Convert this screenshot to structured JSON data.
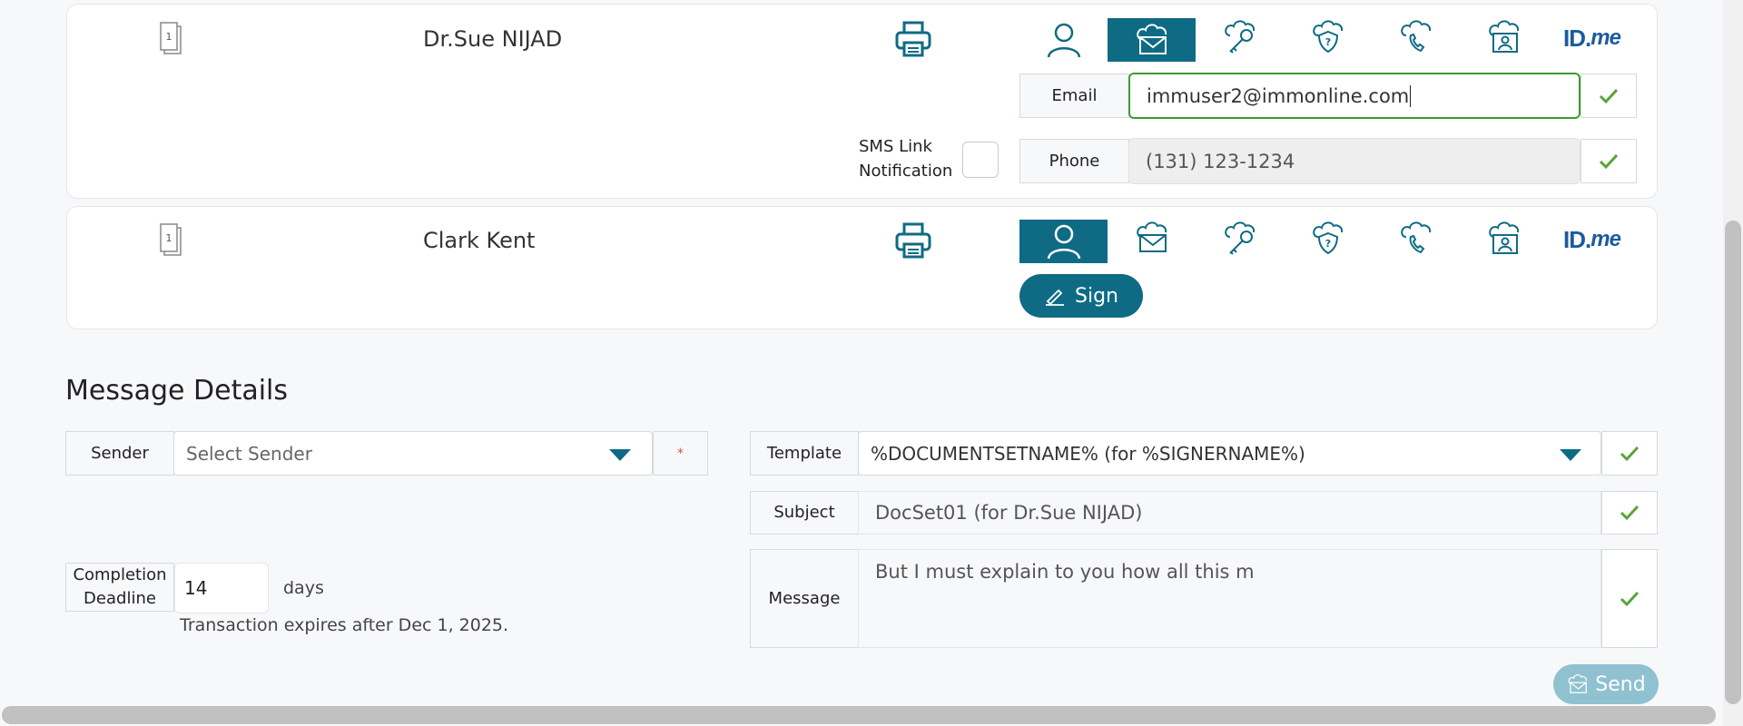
{
  "signers": [
    {
      "doc_count": "1",
      "name": "Dr.Sue NIJAD",
      "email_label": "Email",
      "email_value": "immuser2@immonline.com",
      "phone_label": "Phone",
      "phone_value": "(131) 123-1234",
      "sms_label_line1": "SMS Link",
      "sms_label_line2": "Notification",
      "active_auth": "email"
    },
    {
      "doc_count": "1",
      "name": "Clark Kent",
      "sign_label": "Sign",
      "active_auth": "person"
    }
  ],
  "idme": {
    "id": "ID.",
    "me": "me"
  },
  "message_details": {
    "title": "Message Details",
    "sender_label": "Sender",
    "sender_placeholder": "Select Sender",
    "required_mark": "*",
    "template_label": "Template",
    "template_value": "%DOCUMENTSETNAME% (for %SIGNERNAME%)",
    "subject_label": "Subject",
    "subject_value": "DocSet01 (for Dr.Sue NIJAD)",
    "message_label": "Message",
    "message_value": "But I must explain to you how all this m",
    "deadline_label_line1": "Completion",
    "deadline_label_line2": "Deadline",
    "deadline_value": "14",
    "deadline_unit": "days",
    "expiry_note": "Transaction expires after Dec 1, 2025.",
    "send_label": "Send"
  },
  "colors": {
    "accent": "#0f6b84",
    "check": "#5aa33a",
    "idme": "#1b5b9e"
  }
}
